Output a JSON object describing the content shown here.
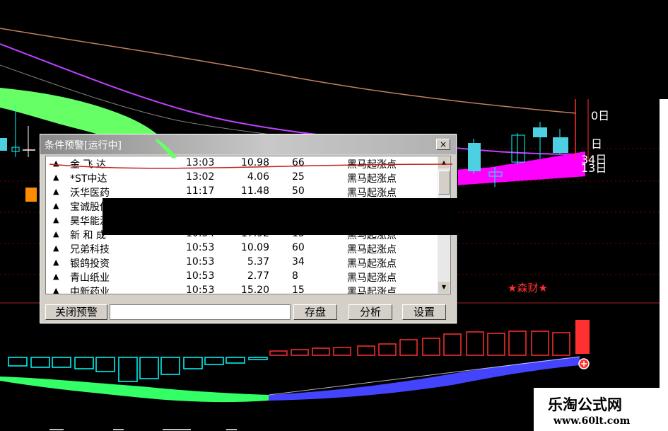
{
  "window": {
    "title": "条件预警[运行中]",
    "close_glyph": "×",
    "rows": [
      {
        "name": "金 飞 达",
        "time": "13:03",
        "price": "10.98",
        "count": "66",
        "signal": "黑马起涨点"
      },
      {
        "name": "*ST中达",
        "time": "13:02",
        "price": "4.06",
        "count": "25",
        "signal": "黑马起涨点"
      },
      {
        "name": "沃华医药",
        "time": "11:17",
        "price": "11.48",
        "count": "50",
        "signal": "黑马起涨点"
      },
      {
        "name": "宝诚股份",
        "time": "",
        "price": "",
        "count": "",
        "signal": ""
      },
      {
        "name": "昊华能源",
        "time": "",
        "price": "",
        "count": "",
        "signal": ""
      },
      {
        "name": "新 和 成",
        "time": "10:54",
        "price": "17.92",
        "count": "15",
        "signal": "黑马起涨点"
      },
      {
        "name": "兄弟科技",
        "time": "10:53",
        "price": "10.09",
        "count": "60",
        "signal": "黑马起涨点"
      },
      {
        "name": "银鸽投资",
        "time": "10:53",
        "price": "5.37",
        "count": "34",
        "signal": "黑马起涨点"
      },
      {
        "name": "青山纸业",
        "time": "10:53",
        "price": "2.77",
        "count": "8",
        "signal": "黑马起涨点"
      },
      {
        "name": "中新药业",
        "time": "10:53",
        "price": "15.20",
        "count": "15",
        "signal": "黑马起涨点"
      }
    ],
    "buttons": {
      "close_alert": "关闭预警",
      "save": "存盘",
      "analyze": "分析",
      "settings": "设置"
    }
  },
  "chart_labels": {
    "label_0": "0日",
    "label_1": "日",
    "label_34": "34日",
    "label_13": "13日",
    "star_text": "★森财★"
  },
  "watermark": {
    "name": "乐淘公式网",
    "url": "www.60lt.com"
  },
  "colors": {
    "up": "#00ffff",
    "down_fill": "#4dd0e1",
    "magenta": "#ff00ff",
    "green_band": "#66ff66",
    "macd_pos": "#ff3030",
    "macd_neg": "#00ffff",
    "wave_green": "#33ff66",
    "wave_blue": "#4444ff"
  }
}
